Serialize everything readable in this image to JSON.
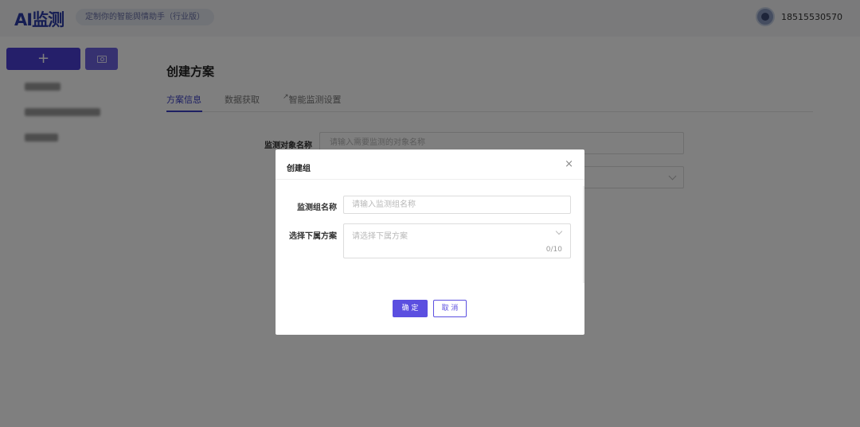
{
  "header": {
    "logo": "AI监测",
    "slogan": "定制你的智能舆情助手（行业版）",
    "user_phone": "18515530570",
    "avatar_icon": "user-avatar-icon"
  },
  "sidebar": {
    "add_label": "+",
    "folder_icon": "folder-icon"
  },
  "main": {
    "title": "创建方案",
    "tabs": [
      {
        "label": "方案信息"
      },
      {
        "label": "数据获取"
      },
      {
        "label": "智能监测设置",
        "icon": "↗"
      }
    ],
    "form": {
      "object_name_label": "监测对象名称",
      "object_name_placeholder": "请输入需要监测的对象名称"
    }
  },
  "modal": {
    "title": "创建组",
    "close_icon": "×",
    "group_name_label": "监测组名称",
    "group_name_placeholder": "请输入监测组名称",
    "plan_label": "选择下属方案",
    "plan_placeholder": "请选择下属方案",
    "plan_count": "0/10",
    "ok_label": "确 定",
    "cancel_label": "取 消"
  },
  "colors": {
    "accent": "#4a3fd4",
    "tab_active": "#3a3fc4"
  }
}
